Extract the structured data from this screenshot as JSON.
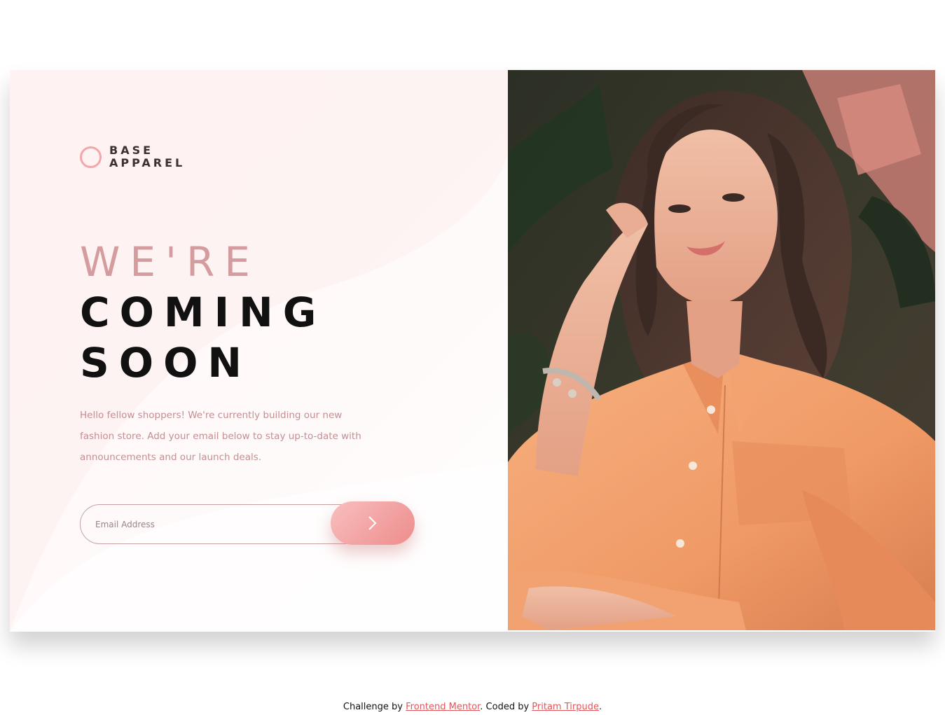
{
  "brand": {
    "line1": "BASE",
    "line2": "APPAREL"
  },
  "hero": {
    "line1": "WE'RE",
    "line2": "COMING",
    "line3": "SOON",
    "description": "Hello fellow shoppers! We're currently building our new fashion store. Add your email below to stay up-to-date with announcements and our launch deals."
  },
  "form": {
    "email_placeholder": "Email Address",
    "email_value": "",
    "submit_icon": "chevron-right-icon"
  },
  "photo": {
    "subject": "woman-in-orange-shirt-photo"
  },
  "footer": {
    "prefix": "Challenge by ",
    "link1": "Frontend Mentor",
    "middle": ". Coded by ",
    "link2": "Pritam Tirpude",
    "suffix": "."
  },
  "colors": {
    "accent": "#ee8c8c",
    "heading_light": "#d49c9f",
    "heading_dark": "#111111",
    "body_text": "#c48e92",
    "link": "#e0565b"
  }
}
